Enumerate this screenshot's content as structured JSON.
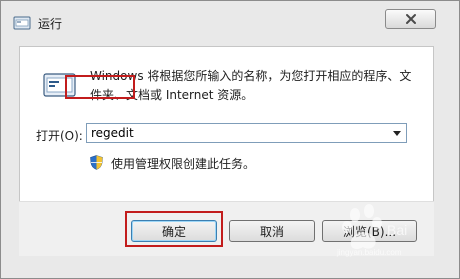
{
  "window": {
    "title": "运行",
    "icon": "run-app-icon",
    "close_icon": "close-icon"
  },
  "dialog": {
    "description": "Windows 将根据您所输入的名称，为您打开相应的程序、文件夹、文档或 Internet 资源。",
    "open_label": "打开(O):",
    "open_input_value": "regedit",
    "admin_note": "使用管理权限创建此任务。"
  },
  "buttons": {
    "ok": "确定",
    "cancel": "取消",
    "browse": "浏览(B)..."
  },
  "watermark": {
    "text": "jingyan.baidu.com"
  },
  "colors": {
    "highlight": "#c21c1c",
    "close_red": "#c4483a"
  }
}
